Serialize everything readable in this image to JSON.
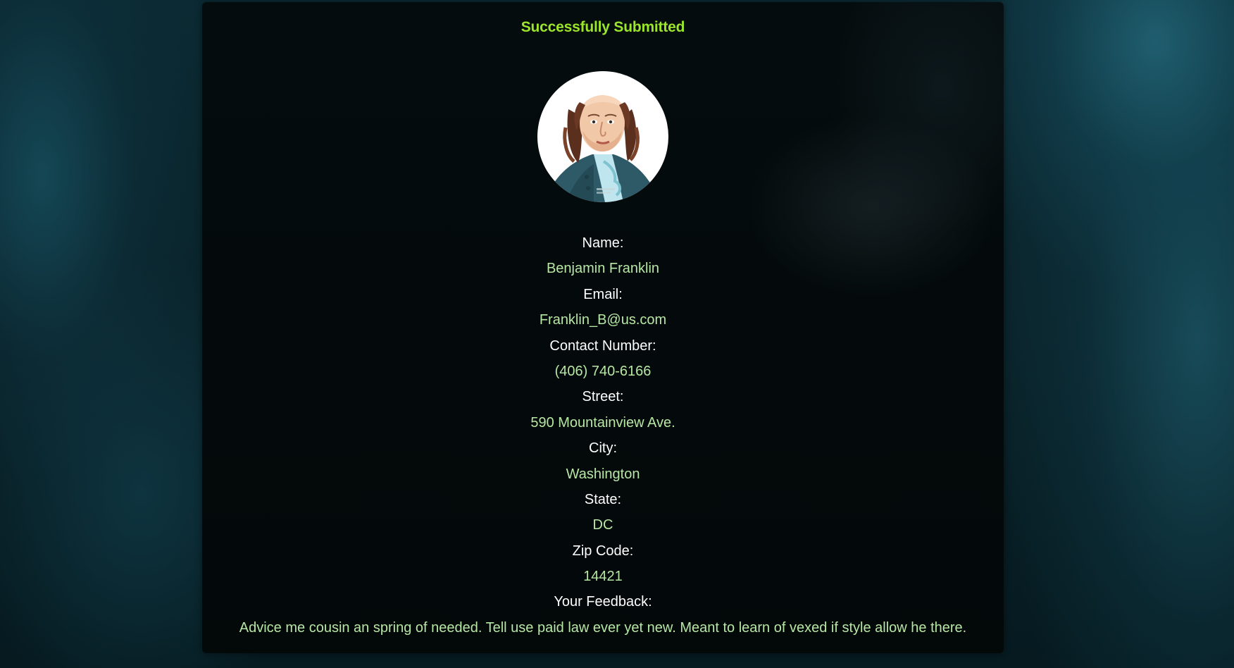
{
  "status_message": "Successfully Submitted",
  "avatar": {
    "icon": "benjamin-franklin-portrait-icon"
  },
  "fields": [
    {
      "label": "Name:",
      "value": "Benjamin Franklin"
    },
    {
      "label": "Email:",
      "value": "Franklin_B@us.com"
    },
    {
      "label": "Contact Number:",
      "value": "(406) 740-6166"
    },
    {
      "label": "Street:",
      "value": "590 Mountainview Ave."
    },
    {
      "label": "City:",
      "value": "Washington"
    },
    {
      "label": "State:",
      "value": "DC"
    },
    {
      "label": "Zip Code:",
      "value": "14421"
    },
    {
      "label": "Your Feedback:",
      "value": "Advice me cousin an spring of needed. Tell use paid law ever yet new. Meant to learn of vexed if style allow he there."
    }
  ],
  "colors": {
    "status": "#9be62a",
    "label": "#ffffff",
    "value": "#b7e7a4",
    "card": "#040a0c"
  }
}
